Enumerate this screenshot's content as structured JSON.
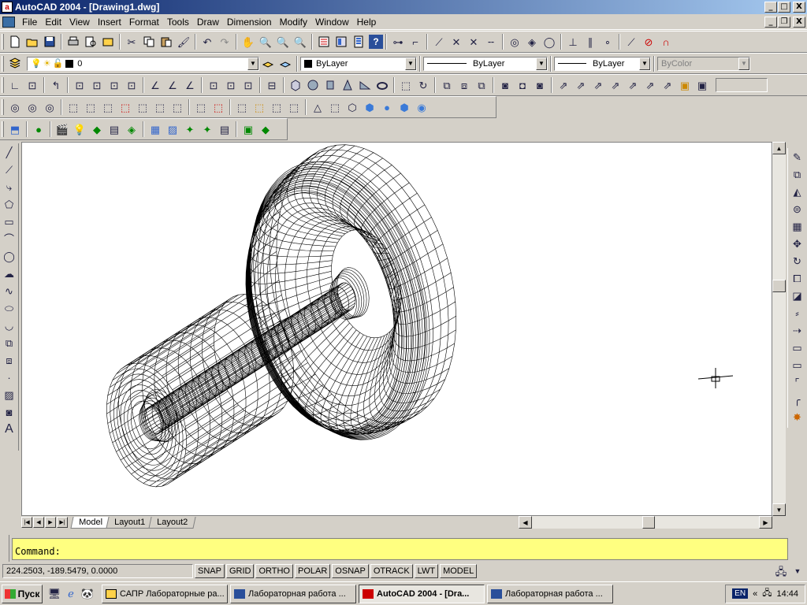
{
  "window": {
    "app_letter": "a",
    "title": "AutoCAD 2004 - [Drawing1.dwg]"
  },
  "title_controls": [
    "_",
    "□",
    "X"
  ],
  "doc_controls": [
    "_",
    "❐",
    "X"
  ],
  "menu": [
    "File",
    "Edit",
    "View",
    "Insert",
    "Format",
    "Tools",
    "Draw",
    "Dimension",
    "Modify",
    "Window",
    "Help"
  ],
  "layers": {
    "current": "0",
    "color": "ByLayer",
    "linetype": "ByLayer",
    "lineweight": "ByLayer",
    "plotstyle": "ByColor"
  },
  "layout_tabs": [
    "Model",
    "Layout1",
    "Layout2"
  ],
  "command": {
    "prompt": "Command:"
  },
  "status": {
    "coords": "224.2503, -189.5479, 0.0000",
    "buttons": [
      "SNAP",
      "GRID",
      "ORTHO",
      "POLAR",
      "OSNAP",
      "OTRACK",
      "LWT",
      "MODEL"
    ]
  },
  "taskbar": {
    "start": "Пуск",
    "tasks": [
      "САПР Лабораторные ра...",
      "Лабораторная работа ...",
      "AutoCAD 2004 - [Dra...",
      "Лабораторная работа ..."
    ],
    "lang": "EN",
    "clock": "14:44"
  },
  "colors": {
    "titlebar_start": "#0a246a",
    "command_bg": "#ffff80",
    "face": "#d4d0c8"
  },
  "icons": {
    "toolbar1": [
      "new-icon",
      "open-icon",
      "save-icon",
      "plot-icon",
      "plot-preview-icon",
      "publish-icon",
      "cut-icon",
      "copy-icon",
      "paste-icon",
      "match-properties-icon",
      "undo-icon",
      "redo-icon",
      "pan-icon",
      "zoom-realtime-icon",
      "zoom-window-icon",
      "zoom-previous-icon",
      "properties-icon",
      "design-center-icon",
      "tool-palettes-icon",
      "help-icon"
    ],
    "left_draw": [
      "line-icon",
      "construction-line-icon",
      "polyline-icon",
      "polygon-icon",
      "rectangle-icon",
      "arc-icon",
      "circle-icon",
      "revision-cloud-icon",
      "spline-icon",
      "ellipse-icon",
      "ellipse-arc-icon",
      "insert-block-icon",
      "make-block-icon",
      "point-icon",
      "hatch-icon",
      "region-icon",
      "multiline-text-icon"
    ],
    "right_modify": [
      "erase-icon",
      "copy-object-icon",
      "mirror-icon",
      "offset-icon",
      "array-icon",
      "move-icon",
      "rotate-icon",
      "scale-icon",
      "stretch-icon",
      "trim-icon",
      "extend-icon",
      "break-at-point-icon",
      "break-icon",
      "chamfer-icon",
      "fillet-icon",
      "explode-icon"
    ]
  }
}
